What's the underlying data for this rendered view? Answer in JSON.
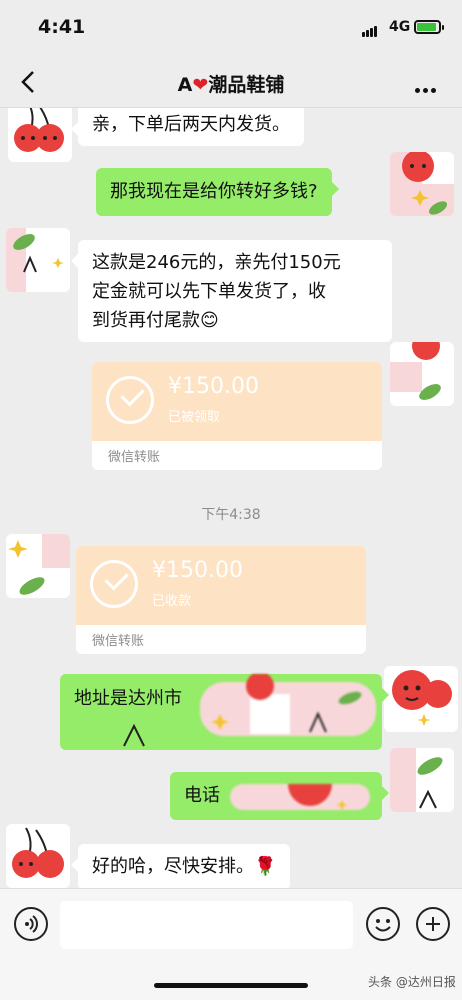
{
  "status": {
    "time": "4:41",
    "network": "4G"
  },
  "nav": {
    "title_prefix": "A",
    "title_suffix": "潮品鞋铺"
  },
  "messages": {
    "m1": "亲，下单后两天内发货。",
    "m2": "那我现在是给你转好多钱?",
    "m3_line1": "这款是246元的，亲先付150元",
    "m3_line2": "定金就可以先下单发货了，收",
    "m3_line3": "到货再付尾款😊",
    "transfer1": {
      "amount": "¥150.00",
      "status": "已被领取",
      "label": "微信转账"
    },
    "timestamp": "下午4:38",
    "transfer2": {
      "amount": "¥150.00",
      "status": "已收款",
      "label": "微信转账"
    },
    "m4": "地址是达州市",
    "m5": "电话",
    "m6": "好的哈，尽快安排。🌹"
  },
  "watermark": "头条 @达州日报",
  "colors": {
    "green_bubble": "#95ec69",
    "transfer_orange": "#fde2c4",
    "background": "#ededed"
  }
}
